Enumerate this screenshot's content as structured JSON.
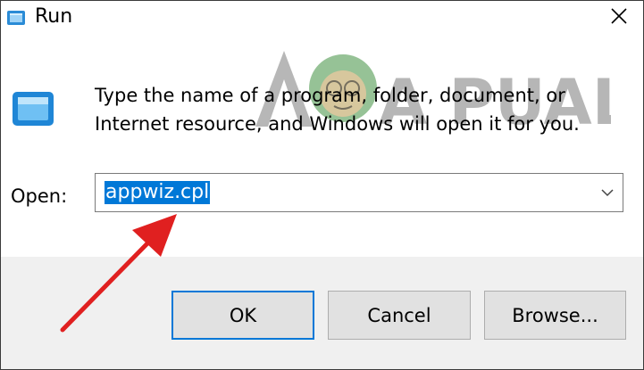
{
  "window": {
    "title": "Run",
    "close_icon": "close-icon",
    "app_icon": "run-app-icon"
  },
  "watermark": {
    "text": "A PUALS"
  },
  "dialog": {
    "description_line1": "Type the name of a program, folder, document, or",
    "description_line2": "Internet resource, and Windows will open it for you.",
    "open_label": "Open:",
    "open_value": "appwiz.cpl"
  },
  "buttons": {
    "ok": "OK",
    "cancel": "Cancel",
    "browse": "Browse..."
  },
  "colors": {
    "selection": "#0078d7",
    "annotation_arrow": "#e02020",
    "footer_bg": "#f0f0f0",
    "button_bg": "#e1e1e1"
  }
}
